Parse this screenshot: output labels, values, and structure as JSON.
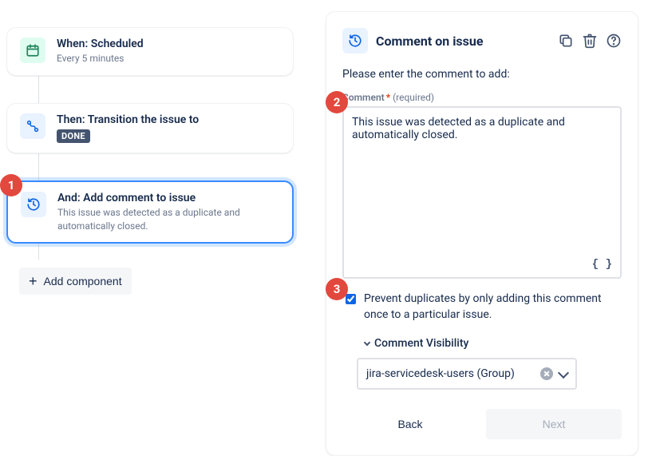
{
  "flow": {
    "trigger": {
      "title": "When: Scheduled",
      "sub": "Every 5 minutes"
    },
    "action1": {
      "title": "Then: Transition the issue to",
      "badge": "DONE"
    },
    "action2": {
      "title": "And: Add comment to issue",
      "sub": "This issue was detected as a duplicate and automatically closed."
    },
    "add_button": "Add component"
  },
  "panel": {
    "title": "Comment on issue",
    "prompt": "Please enter the comment to add:",
    "comment_label": "Comment",
    "required_hint": "(required)",
    "comment_value": "This issue was detected as a duplicate and automatically closed.",
    "code_btn": "{ }",
    "checkbox_label": "Prevent duplicates by only adding this comment once to a particular issue.",
    "checkbox_checked": true,
    "visibility_label": "Comment Visibility",
    "visibility_value": "jira-servicedesk-users (Group)",
    "back": "Back",
    "next": "Next"
  },
  "annotations": {
    "n1": "1",
    "n2": "2",
    "n3": "3"
  }
}
